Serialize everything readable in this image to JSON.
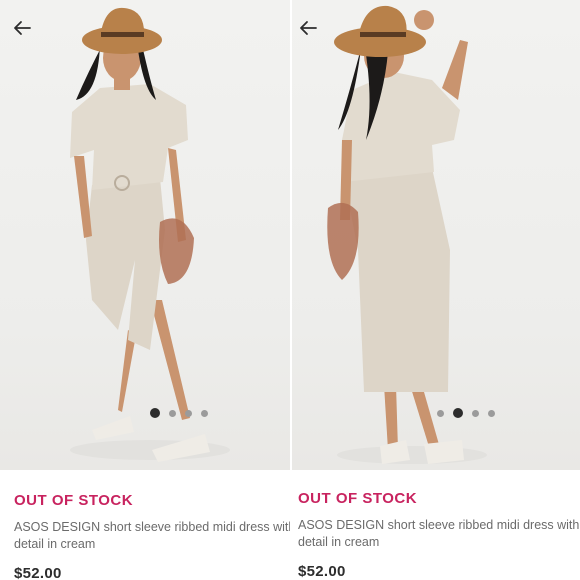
{
  "panels": [
    {
      "status": "OUT OF STOCK",
      "product_title": "ASOS DESIGN short sleeve ribbed midi dress with detail in cream",
      "price": "$52.00",
      "carousel": {
        "count": 4,
        "active_index": 0
      },
      "back_icon": "arrow-left-icon"
    },
    {
      "status": "OUT OF STOCK",
      "product_title": "ASOS DESIGN short sleeve ribbed midi dress with detail in cream",
      "price": "$52.00",
      "carousel": {
        "count": 4,
        "active_index": 1
      },
      "back_icon": "arrow-left-icon"
    }
  ],
  "colors": {
    "status": "#c8235f",
    "price": "#2d2d2d",
    "title": "#6b6b6b",
    "dress": "#ddd5c8",
    "hat": "#b8814a",
    "background": "#f0f0ee"
  }
}
